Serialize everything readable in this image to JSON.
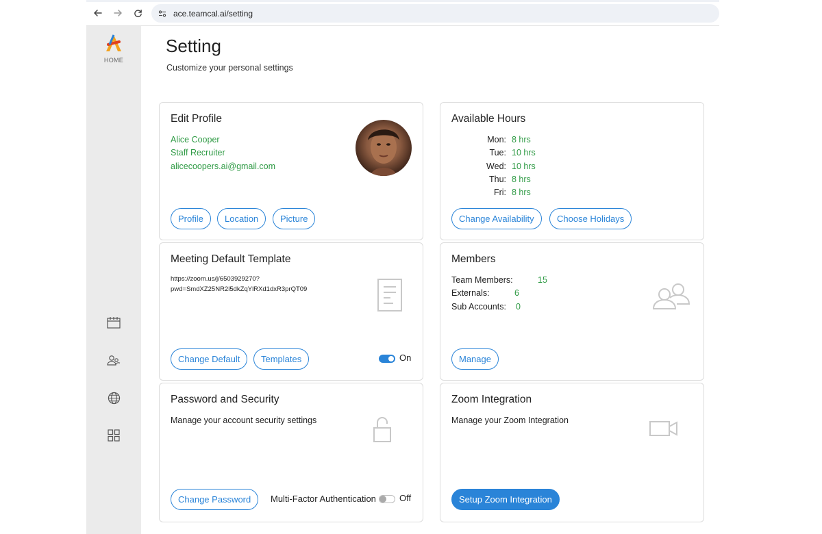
{
  "browser": {
    "url": "ace.teamcal.ai/setting"
  },
  "sidebar": {
    "home_label": "HOME",
    "icons": [
      "calendar-icon",
      "users-icon",
      "globe-icon",
      "apps-grid-icon"
    ]
  },
  "header": {
    "title": "Setting",
    "subtitle": "Customize your personal settings"
  },
  "edit_profile": {
    "title": "Edit Profile",
    "name": "Alice Cooper",
    "role": "Staff Recruiter",
    "email": "alicecoopers.ai@gmail.com",
    "buttons": [
      "Profile",
      "Location",
      "Picture"
    ]
  },
  "available_hours": {
    "title": "Available Hours",
    "days": [
      {
        "day": "Mon:",
        "hours": "8 hrs"
      },
      {
        "day": "Tue:",
        "hours": "10 hrs"
      },
      {
        "day": "Wed:",
        "hours": "10 hrs"
      },
      {
        "day": "Thu:",
        "hours": "8 hrs"
      },
      {
        "day": "Fri:",
        "hours": "8 hrs"
      }
    ],
    "buttons": [
      "Change Availability",
      "Choose Holidays"
    ]
  },
  "meeting_template": {
    "title": "Meeting Default Template",
    "link_line1": "https://zoom.us/j/6503929270?",
    "link_line2": "pwd=SmdXZ25NR2l5dkZqYlRXd1dxR3prQT09",
    "buttons": [
      "Change Default",
      "Templates"
    ],
    "toggle_label": "On",
    "toggle_on": true
  },
  "members": {
    "title": "Members",
    "rows": [
      {
        "label": "Team Members:",
        "value": "15"
      },
      {
        "label": "Externals:",
        "value": "6"
      },
      {
        "label": "Sub Accounts:",
        "value": "0"
      }
    ],
    "button": "Manage"
  },
  "password_security": {
    "title": "Password and Security",
    "description": "Manage your account security settings",
    "button": "Change Password",
    "mfa_label": "Multi-Factor Authentication",
    "toggle_label": "Off",
    "toggle_on": false
  },
  "zoom": {
    "title": "Zoom Integration",
    "description": "Manage your Zoom Integration",
    "button": "Setup Zoom Integration"
  },
  "colors": {
    "accent": "#2a84d8",
    "green_text": "#2e9a44",
    "sidebar_bg": "#ebebeb"
  }
}
